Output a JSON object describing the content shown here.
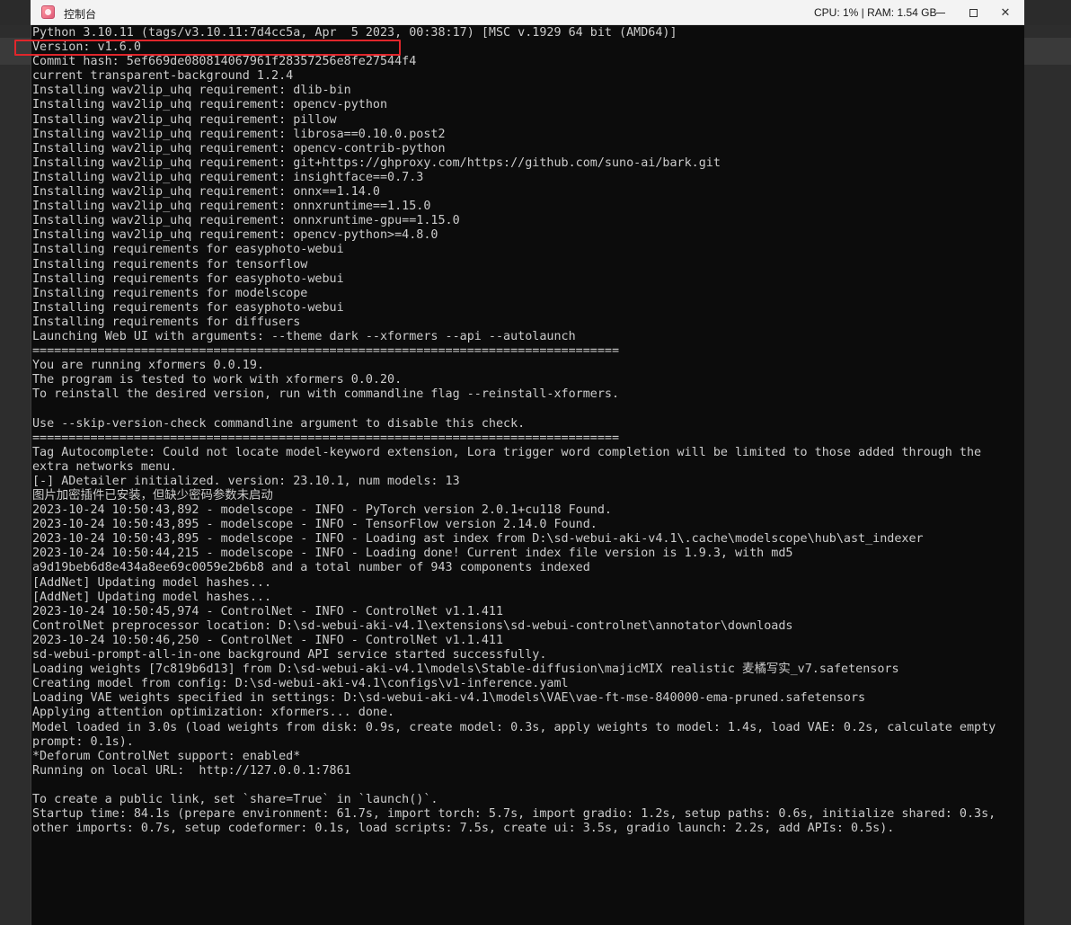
{
  "window": {
    "title": "控制台",
    "status": "CPU: 1% | RAM: 1.54 GB",
    "minimize_symbol": "",
    "maximize_symbol": "",
    "close_symbol": "✕"
  },
  "colors": {
    "console_bg": "#0c0c0c",
    "console_text": "#cccccc",
    "highlight": "#e0262b",
    "titlebar_bg": "#f3f3f3"
  },
  "console": {
    "lines": [
      "Python 3.10.11 (tags/v3.10.11:7d4cc5a, Apr  5 2023, 00:38:17) [MSC v.1929 64 bit (AMD64)]",
      "Version: v1.6.0",
      "Commit hash: 5ef669de080814067961f28357256e8fe27544f4",
      "current transparent-background 1.2.4",
      "Installing wav2lip_uhq requirement: dlib-bin",
      "Installing wav2lip_uhq requirement: opencv-python",
      "Installing wav2lip_uhq requirement: pillow",
      "Installing wav2lip_uhq requirement: librosa==0.10.0.post2",
      "Installing wav2lip_uhq requirement: opencv-contrib-python",
      "Installing wav2lip_uhq requirement: git+https://ghproxy.com/https://github.com/suno-ai/bark.git",
      "Installing wav2lip_uhq requirement: insightface==0.7.3",
      "Installing wav2lip_uhq requirement: onnx==1.14.0",
      "Installing wav2lip_uhq requirement: onnxruntime==1.15.0",
      "Installing wav2lip_uhq requirement: onnxruntime-gpu==1.15.0",
      "Installing wav2lip_uhq requirement: opencv-python>=4.8.0",
      "Installing requirements for easyphoto-webui",
      "Installing requirements for tensorflow",
      "Installing requirements for easyphoto-webui",
      "Installing requirements for modelscope",
      "Installing requirements for easyphoto-webui",
      "Installing requirements for diffusers",
      "Launching Web UI with arguments: --theme dark --xformers --api --autolaunch",
      "=================================================================================",
      "You are running xformers 0.0.19.",
      "The program is tested to work with xformers 0.0.20.",
      "To reinstall the desired version, run with commandline flag --reinstall-xformers.",
      "",
      "Use --skip-version-check commandline argument to disable this check.",
      "=================================================================================",
      "Tag Autocomplete: Could not locate model-keyword extension, Lora trigger word completion will be limited to those added through the",
      "extra networks menu.",
      "[-] ADetailer initialized. version: 23.10.1, num models: 13",
      "图片加密插件已安装，但缺少密码参数未启动",
      "2023-10-24 10:50:43,892 - modelscope - INFO - PyTorch version 2.0.1+cu118 Found.",
      "2023-10-24 10:50:43,895 - modelscope - INFO - TensorFlow version 2.14.0 Found.",
      "2023-10-24 10:50:43,895 - modelscope - INFO - Loading ast index from D:\\sd-webui-aki-v4.1\\.cache\\modelscope\\hub\\ast_indexer",
      "2023-10-24 10:50:44,215 - modelscope - INFO - Loading done! Current index file version is 1.9.3, with md5",
      "a9d19beb6d8e434a8ee69c0059e2b6b8 and a total number of 943 components indexed",
      "[AddNet] Updating model hashes...",
      "[AddNet] Updating model hashes...",
      "2023-10-24 10:50:45,974 - ControlNet - INFO - ControlNet v1.1.411",
      "ControlNet preprocessor location: D:\\sd-webui-aki-v4.1\\extensions\\sd-webui-controlnet\\annotator\\downloads",
      "2023-10-24 10:50:46,250 - ControlNet - INFO - ControlNet v1.1.411",
      "sd-webui-prompt-all-in-one background API service started successfully.",
      "Loading weights [7c819b6d13] from D:\\sd-webui-aki-v4.1\\models\\Stable-diffusion\\majicMIX realistic 麦橘写实_v7.safetensors",
      "Creating model from config: D:\\sd-webui-aki-v4.1\\configs\\v1-inference.yaml",
      "Loading VAE weights specified in settings: D:\\sd-webui-aki-v4.1\\models\\VAE\\vae-ft-mse-840000-ema-pruned.safetensors",
      "Applying attention optimization: xformers... done.",
      "Model loaded in 3.0s (load weights from disk: 0.9s, create model: 0.3s, apply weights to model: 1.4s, load VAE: 0.2s, calculate empty",
      "prompt: 0.1s).",
      "*Deforum ControlNet support: enabled*",
      "Running on local URL:  http://127.0.0.1:7861",
      "",
      "To create a public link, set `share=True` in `launch()`.",
      "Startup time: 84.1s (prepare environment: 61.7s, import torch: 5.7s, import gradio: 1.2s, setup paths: 0.6s, initialize shared: 0.3s,",
      "other imports: 0.7s, setup codeformer: 0.1s, load scripts: 7.5s, create ui: 3.5s, gradio launch: 2.2s, add APIs: 0.5s)."
    ]
  }
}
